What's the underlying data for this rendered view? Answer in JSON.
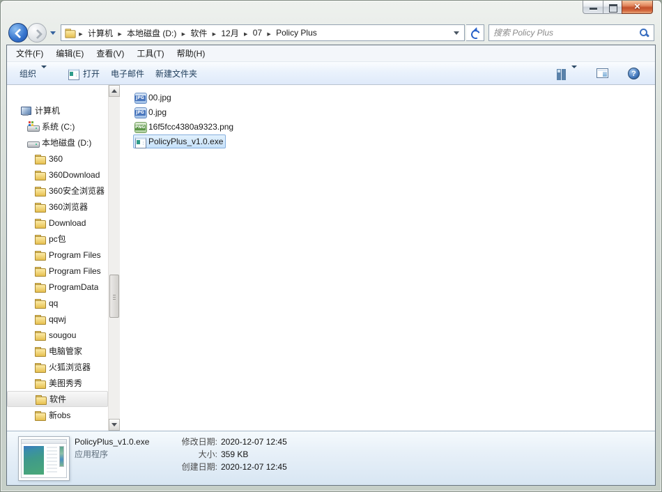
{
  "window": {
    "controls": {
      "minimize": "minimize",
      "maximize": "maximize",
      "close": "close"
    }
  },
  "nav": {
    "breadcrumb": [
      {
        "label": "计算机"
      },
      {
        "label": "本地磁盘 (D:)"
      },
      {
        "label": "软件"
      },
      {
        "label": "12月"
      },
      {
        "label": "07"
      },
      {
        "label": "Policy Plus"
      }
    ],
    "search_placeholder": "搜索 Policy Plus"
  },
  "menu": {
    "items": [
      {
        "label": "文件(F)"
      },
      {
        "label": "编辑(E)"
      },
      {
        "label": "查看(V)"
      },
      {
        "label": "工具(T)"
      },
      {
        "label": "帮助(H)"
      }
    ]
  },
  "toolbar": {
    "organize_label": "组织",
    "open_label": "打开",
    "email_label": "电子邮件",
    "new_folder_label": "新建文件夹"
  },
  "sidebar": {
    "items": [
      {
        "label": "计算机",
        "level": 0,
        "icon": "computer"
      },
      {
        "label": "系统 (C:)",
        "level": 1,
        "icon": "drive-c"
      },
      {
        "label": "本地磁盘 (D:)",
        "level": 1,
        "icon": "drive"
      },
      {
        "label": "360",
        "level": 2,
        "icon": "folder"
      },
      {
        "label": "360Download",
        "level": 2,
        "icon": "folder"
      },
      {
        "label": "360安全浏览器",
        "level": 2,
        "icon": "folder"
      },
      {
        "label": "360浏览器",
        "level": 2,
        "icon": "folder"
      },
      {
        "label": "Download",
        "level": 2,
        "icon": "folder"
      },
      {
        "label": "pc包",
        "level": 2,
        "icon": "folder"
      },
      {
        "label": "Program Files",
        "level": 2,
        "icon": "folder"
      },
      {
        "label": "Program Files",
        "level": 2,
        "icon": "folder"
      },
      {
        "label": "ProgramData",
        "level": 2,
        "icon": "folder"
      },
      {
        "label": "qq",
        "level": 2,
        "icon": "folder"
      },
      {
        "label": "qqwj",
        "level": 2,
        "icon": "folder"
      },
      {
        "label": "sougou",
        "level": 2,
        "icon": "folder"
      },
      {
        "label": "电脑管家",
        "level": 2,
        "icon": "folder"
      },
      {
        "label": "火狐浏览器",
        "level": 2,
        "icon": "folder"
      },
      {
        "label": "美图秀秀",
        "level": 2,
        "icon": "folder"
      },
      {
        "label": "软件",
        "level": 2,
        "icon": "folder",
        "selected": true
      },
      {
        "label": "新obs",
        "level": 2,
        "icon": "folder"
      }
    ]
  },
  "files": {
    "items": [
      {
        "name": "00.jpg",
        "icon": "jpg"
      },
      {
        "name": "0.jpg",
        "icon": "jpg"
      },
      {
        "name": "16f5fcc4380a9323.png",
        "icon": "png"
      },
      {
        "name": "PolicyPlus_v1.0.exe",
        "icon": "exe",
        "selected": true
      }
    ]
  },
  "details": {
    "name": "PolicyPlus_v1.0.exe",
    "type": "应用程序",
    "properties": [
      {
        "label": "修改日期:",
        "value": "2020-12-07 12:45"
      },
      {
        "label": "大小:",
        "value": "359 KB"
      },
      {
        "label": "创建日期:",
        "value": "2020-12-07 12:45"
      }
    ]
  },
  "colors": {
    "accent_blue": "#2a62c9",
    "selection_border": "#84aede",
    "close_button_red": "#c2512b",
    "toolbar_text": "#1e3c5a"
  }
}
